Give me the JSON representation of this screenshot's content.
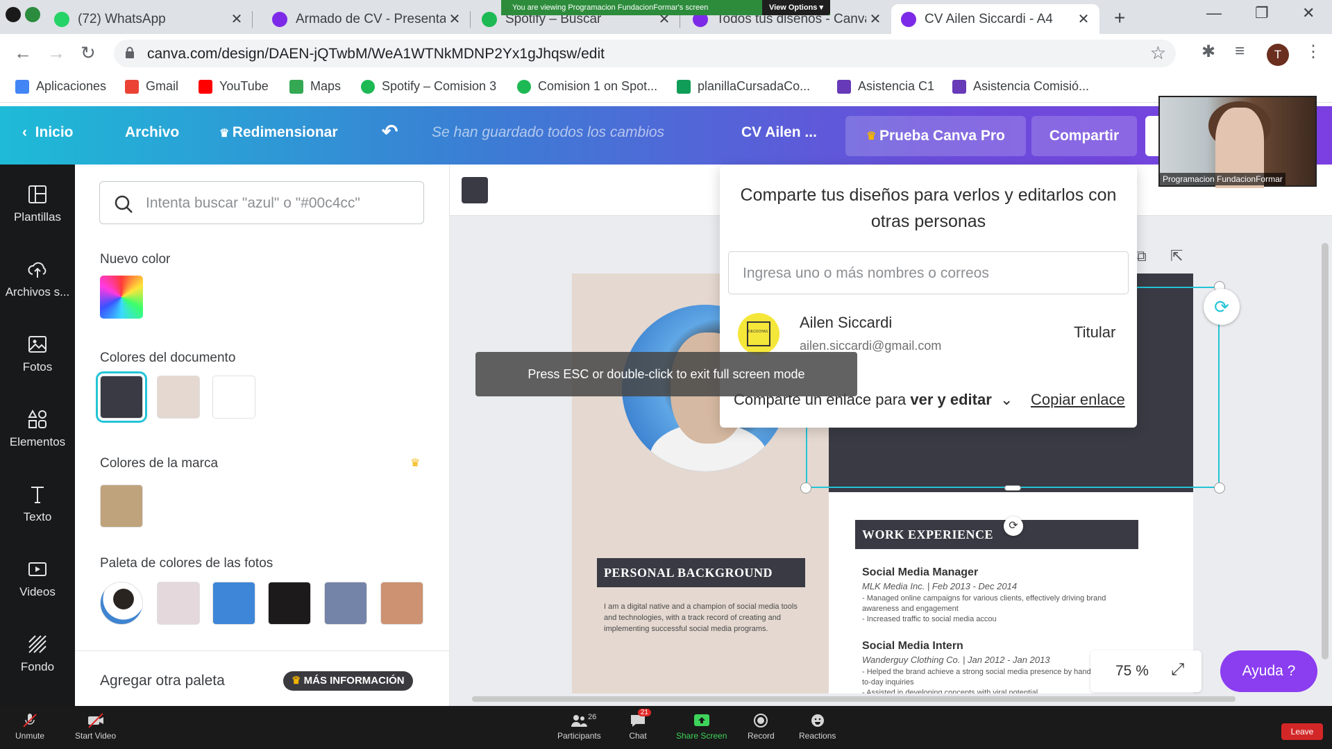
{
  "browser": {
    "tabs": [
      {
        "title": "(72) WhatsApp",
        "color": "#25d366"
      },
      {
        "title": "Armado de CV - Presenta",
        "color": "#7d2ae8"
      },
      {
        "title": "Spotify – Buscar",
        "color": "#1db954"
      },
      {
        "title": "Todos tus diseños - Canva",
        "color": "#7d2ae8"
      },
      {
        "title": "CV Ailen Siccardi - A4",
        "color": "#7d2ae8"
      }
    ],
    "close_glyph": "✕",
    "new_tab_glyph": "+",
    "screen_banner": {
      "message": "You are viewing Programacion FundacionFormar's screen",
      "options_label": "View Options ▾"
    },
    "url": "canva.com/design/DAEN-jQTwbM/WeA1WTNkMDNP2Yx1gJhqsw/edit",
    "profile_initial": "T",
    "bookmarks": [
      {
        "label": "Aplicaciones",
        "icon": "apps-grid-icon",
        "color": "#4285f4"
      },
      {
        "label": "Gmail",
        "icon": "gmail-icon",
        "color": "#ea4335"
      },
      {
        "label": "YouTube",
        "icon": "youtube-icon",
        "color": "#ff0000"
      },
      {
        "label": "Maps",
        "icon": "maps-icon",
        "color": "#34a853"
      },
      {
        "label": "Spotify – Comision 3",
        "icon": "spotify-icon",
        "color": "#1db954"
      },
      {
        "label": "Comision 1 on Spot...",
        "icon": "spotify-icon",
        "color": "#1db954"
      },
      {
        "label": "planillaCursadaCo...",
        "icon": "sheets-icon",
        "color": "#0f9d58"
      },
      {
        "label": "Asistencia C1",
        "icon": "forms-icon",
        "color": "#673ab7"
      },
      {
        "label": "Asistencia Comisió...",
        "icon": "forms-icon",
        "color": "#673ab7"
      }
    ]
  },
  "canva_header": {
    "inicio": "Inicio",
    "archivo": "Archivo",
    "redimensionar": "Redimensionar",
    "saved": "Se han guardado todos los cambios",
    "doc_title": "CV Ailen ...",
    "pro": "Prueba Canva Pro",
    "compartir": "Compartir"
  },
  "sidebar": {
    "items": [
      {
        "label": "Plantillas",
        "icon": "templates-icon"
      },
      {
        "label": "Archivos s...",
        "icon": "upload-cloud-icon"
      },
      {
        "label": "Fotos",
        "icon": "photos-icon"
      },
      {
        "label": "Elementos",
        "icon": "elements-icon"
      },
      {
        "label": "Texto",
        "icon": "text-icon"
      },
      {
        "label": "Videos",
        "icon": "video-icon"
      },
      {
        "label": "Fondo",
        "icon": "background-icon"
      }
    ]
  },
  "color_panel": {
    "search_placeholder": "Intenta buscar \"azul\" o \"#00c4cc\"",
    "nuevo_color": "Nuevo color",
    "colores_documento": "Colores del documento",
    "document_colors": [
      "#3a3a44",
      "#e4d8d0",
      "#ffffff"
    ],
    "colores_marca": "Colores de la marca",
    "brand_colors": [
      "#bfa37c"
    ],
    "paleta_fotos": "Paleta de colores de las fotos",
    "photo_palette": [
      "#e4d8dc",
      "#3e86d8",
      "#1c1a1a",
      "#7484a8",
      "#cc9272"
    ],
    "agregar_paleta": "Agregar otra paleta",
    "mas_informacion": "MÁS INFORMACIÓN"
  },
  "share_popover": {
    "title": "Comparte tus diseños para verlos y editarlos con otras personas",
    "invite_placeholder": "Ingresa uno o más nombres o correos",
    "user_name": "Ailen Siccardi",
    "user_email": "ailen.siccardi@gmail.com",
    "role": "Titular",
    "avatar_text": "DECOCHAS",
    "link_prefix": "Comparte un enlace para",
    "link_mode": "ver y editar",
    "copy_link": "Copiar enlace"
  },
  "fullscreen_notice": "Press ESC or double-click to exit full screen mode",
  "cv_page": {
    "personal_heading": "PERSONAL BACKGROUND",
    "personal_text": "I am a digital native and a champion of social media tools and technologies, with a track record of creating and implementing successful social media programs.",
    "work_heading": "WORK EXPERIENCE",
    "jobs": [
      {
        "title": "Social Media Manager",
        "company": "MLK Media Inc. | Feb 2013 - Dec 2014",
        "bullets": "- Managed online campaigns for various clients, effectively driving brand awareness and engagement\n- Increased traffic to social media accou"
      },
      {
        "title": "Social Media Intern",
        "company": "Wanderguy Clothing Co. | Jan 2012 - Jan 2013",
        "bullets": "- Helped the brand achieve a strong social media presence by handling day-to-day inquiries\n- Assisted in developing concepts with viral potential"
      }
    ]
  },
  "zoom_level": "75 %",
  "ayuda": "Ayuda  ?",
  "video_label": "Programacion FundacionFormar",
  "zoom_meeting": {
    "unmute": "Unmute",
    "start_video": "Start Video",
    "participants": "Participants",
    "participants_count": "26",
    "chat": "Chat",
    "chat_badge": "21",
    "share_screen": "Share Screen",
    "record": "Record",
    "reactions": "Reactions",
    "leave": "Leave"
  }
}
